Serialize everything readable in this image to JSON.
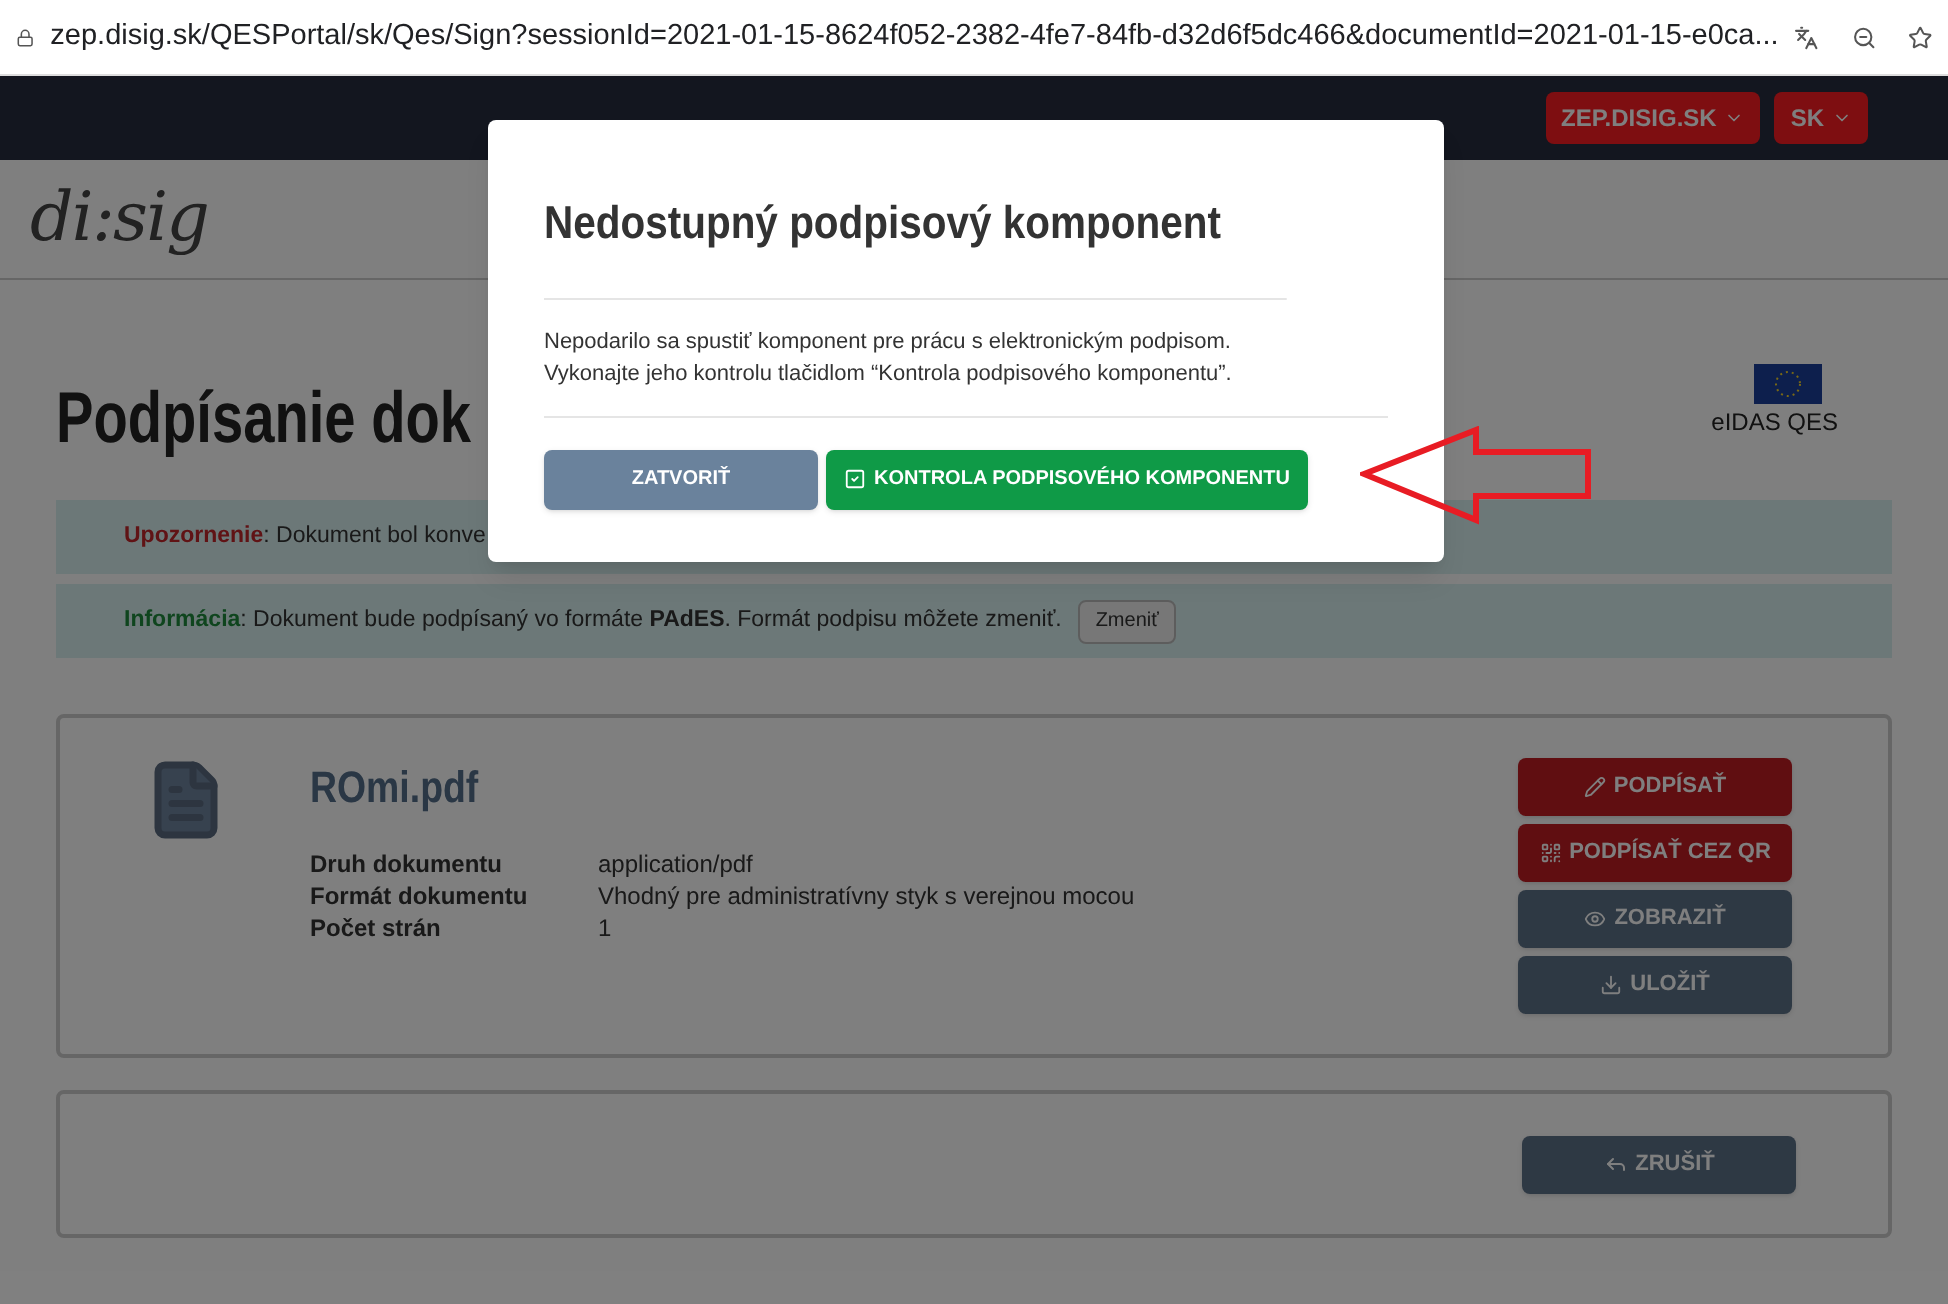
{
  "browser": {
    "url": "zep.disig.sk/QESPortal/sk/Qes/Sign?sessionId=2021-01-15-8624f052-2382-4fe7-84fb-d32d6f5dc466&documentId=2021-01-15-e0ca..."
  },
  "navbar": {
    "menus": [
      "ZEP.DISIG.SK",
      "SK"
    ]
  },
  "logo": {
    "text": "di:sig"
  },
  "page_title": "Podpísanie dok",
  "badge": {
    "label": "eIDAS QES"
  },
  "alerts": [
    {
      "kind": "warning",
      "label": "Upozornenie",
      "text": ": Dokument bol konve"
    },
    {
      "kind": "info",
      "label": "Informácia",
      "text": ": Dokument bude podpísaný vo formáte **PAdES**. Formát podpisu môžete zmeniť.",
      "button": "Zmeniť"
    }
  ],
  "document": {
    "name": "ROmi.pdf",
    "properties": [
      {
        "label": "Druh dokumentu",
        "value": "application/pdf"
      },
      {
        "label": "Formát dokumentu",
        "value": "Vhodný pre administratívny styk s verejnou mocou"
      },
      {
        "label": "Počet strán",
        "value": "1"
      }
    ],
    "actions": [
      {
        "kind": "sign",
        "label": "PODPÍSAŤ"
      },
      {
        "kind": "qr",
        "label": "PODPÍSAŤ CEZ QR"
      },
      {
        "kind": "view",
        "label": "ZOBRAZIŤ"
      },
      {
        "kind": "save",
        "label": "ULOŽIŤ"
      }
    ]
  },
  "cancel_button": "ZRUŠIŤ",
  "dialog": {
    "title": "Nedostupný podpisový komponent",
    "lines": [
      "Nepodarilo sa spustiť komponent pre prácu s elektronickým podpisom.",
      "Vykonajte jeho kontrolu tlačidlom “Kontrola podpisového komponentu”."
    ],
    "buttons": [
      {
        "kind": "close",
        "label": "ZATVORIŤ"
      },
      {
        "kind": "check",
        "label": "KONTROLA PODPISOVÉHO KOMPONENTU"
      }
    ]
  }
}
